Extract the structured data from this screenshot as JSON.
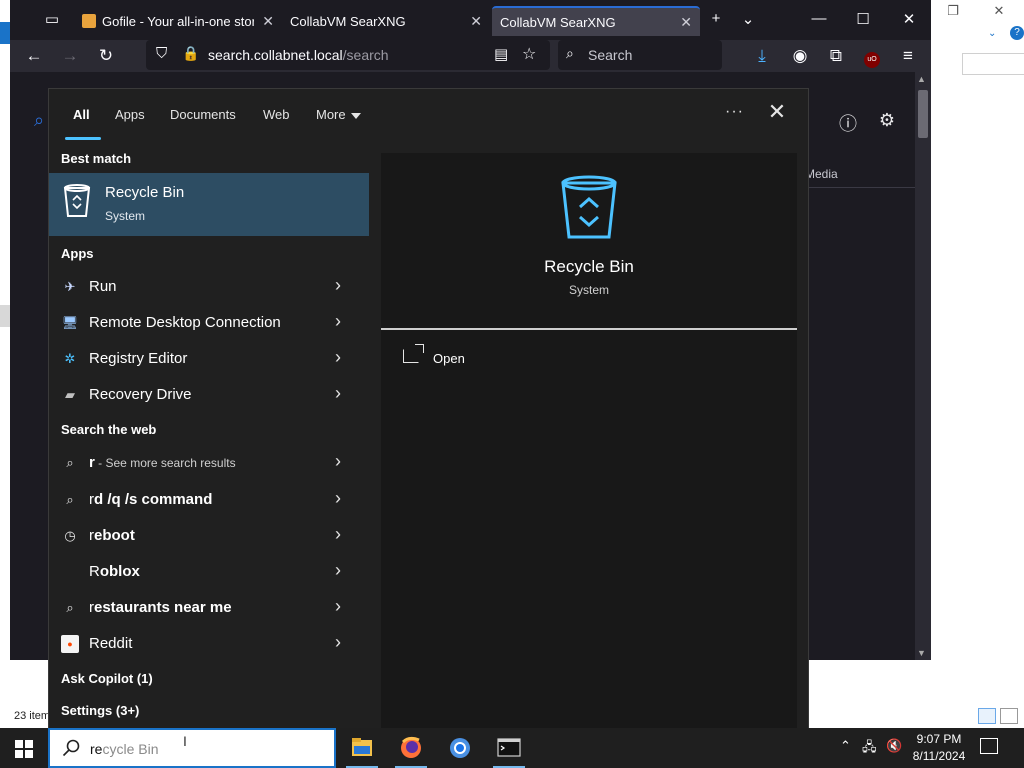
{
  "explorer": {
    "items_count": "23 item"
  },
  "browser": {
    "tabs": [
      {
        "title": "Gofile - Your all-in-one stora",
        "active": false
      },
      {
        "title": "CollabVM SearXNG",
        "active": false
      },
      {
        "title": "CollabVM SearXNG",
        "active": true
      }
    ],
    "url": {
      "host": "search.collabnet.local",
      "path": "/search"
    },
    "search_placeholder": "Search",
    "page_tab_media": "Media"
  },
  "search_panel": {
    "tabs": [
      "All",
      "Apps",
      "Documents",
      "Web",
      "More"
    ],
    "best_match_heading": "Best match",
    "best_match": {
      "title": "Recycle Bin",
      "subtitle": "System"
    },
    "apps_heading": "Apps",
    "apps": [
      {
        "label": "Run",
        "icon": "run-icon"
      },
      {
        "label": "Remote Desktop Connection",
        "icon": "remote-desktop-icon"
      },
      {
        "label": "Registry Editor",
        "icon": "registry-editor-icon"
      },
      {
        "label": "Recovery Drive",
        "icon": "recovery-drive-icon"
      }
    ],
    "web_heading": "Search the web",
    "web": [
      {
        "prefix": "r",
        "suffix": " - See more search results",
        "icon": "search-icon"
      },
      {
        "prefix": "r",
        "suffix": "d /q /s command",
        "icon": "search-icon"
      },
      {
        "prefix": "r",
        "suffix": "eboot",
        "icon": "history-icon"
      },
      {
        "prefix": "R",
        "suffix": "oblox",
        "icon": "none"
      },
      {
        "prefix": "r",
        "suffix": "estaurants near me",
        "icon": "search-icon"
      },
      {
        "prefix": "R",
        "suffix": "eddit",
        "icon": "reddit-icon"
      }
    ],
    "copilot_heading": "Ask Copilot (1)",
    "settings_heading": "Settings (3+)",
    "detail": {
      "title": "Recycle Bin",
      "subtitle": "System",
      "action_label": "Open"
    }
  },
  "taskbar": {
    "search_typed": "re",
    "search_ghost": "cycle Bin",
    "clock_time": "9:07 PM",
    "clock_date": "8/11/2024"
  },
  "colors": {
    "selection": "#2d4d63",
    "accent": "#4cc2ff",
    "panel": "#202020"
  }
}
